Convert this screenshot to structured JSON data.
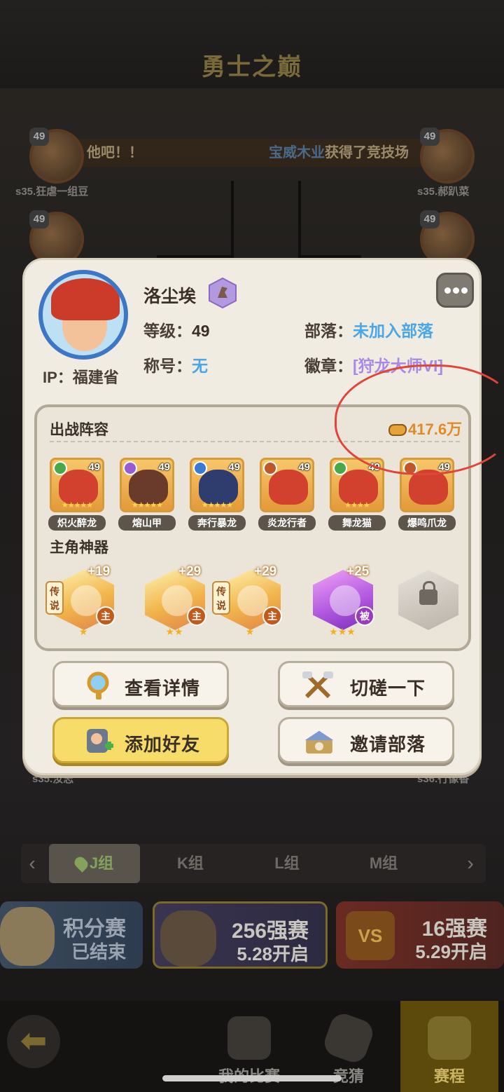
{
  "header": {
    "title": "勇士之巅"
  },
  "ticker": {
    "left_text": "他吧！！",
    "highlight_name": "宝威木业",
    "right_text": "获得了竞技场"
  },
  "bg_players": [
    {
      "level": "49",
      "name": "s35.狂虐一组豆"
    },
    {
      "level": "49",
      "name": "s35.郝趴菜"
    },
    {
      "level": "49",
      "name": ""
    },
    {
      "level": "49",
      "name": ""
    },
    {
      "level": "",
      "name": "s35.汝志"
    },
    {
      "level": "",
      "name": "s36.行像香"
    }
  ],
  "profile": {
    "name": "洛尘埃",
    "level_label": "等级：",
    "level": "49",
    "title_label": "称号：",
    "title": "无",
    "tribe_label": "部落：",
    "tribe": "未加入部落",
    "badge_label": "徽章：",
    "badge": "[狩龙大师VI]",
    "ip": "IP：福建省"
  },
  "lineup": {
    "title": "出战阵容",
    "power": "417.6万",
    "heroes": [
      {
        "name": "炽火醉龙",
        "level": "49"
      },
      {
        "name": "熔山甲",
        "level": "49"
      },
      {
        "name": "奔行暴龙",
        "level": "49"
      },
      {
        "name": "炎龙行者",
        "level": "49"
      },
      {
        "name": "舞龙猫",
        "level": "49"
      },
      {
        "name": "爆鸣爪龙",
        "level": "49"
      }
    ]
  },
  "artifacts": {
    "title": "主角神器",
    "items": [
      {
        "plus": "+19",
        "legend": "传说",
        "role": "主"
      },
      {
        "plus": "+29",
        "legend": "",
        "role": "主"
      },
      {
        "plus": "+29",
        "legend": "传说",
        "role": "主"
      },
      {
        "plus": "+25",
        "legend": "",
        "role": "被"
      }
    ]
  },
  "buttons": {
    "details": "查看详情",
    "spar": "切磋一下",
    "add_friend": "添加好友",
    "invite_tribe": "邀请部落"
  },
  "groups": {
    "tabs": [
      "J组",
      "K组",
      "L组",
      "M组"
    ],
    "active": "J组"
  },
  "stages": [
    {
      "line1": "积分赛",
      "line2": "已结束"
    },
    {
      "line1": "256强赛",
      "line2": "5.28开启"
    },
    {
      "line1": "16强赛",
      "line2": "5.29开启",
      "vs": "VS"
    }
  ],
  "bottom_nav": {
    "my_matches": "我的比赛",
    "guess": "竞猜",
    "schedule": "赛程"
  }
}
